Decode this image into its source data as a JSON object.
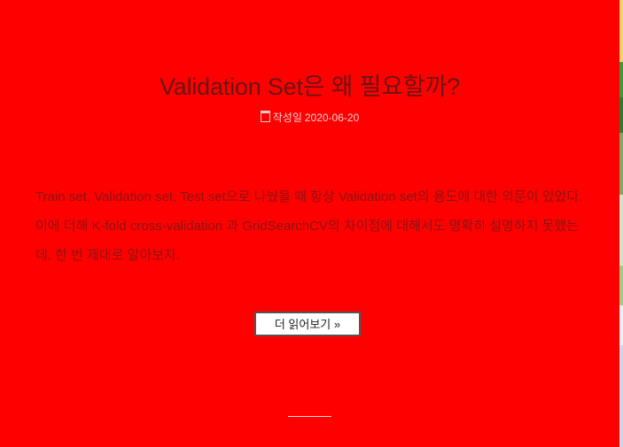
{
  "post": {
    "title": "Validation Set은 왜 필요할까?",
    "meta_label": "작성일",
    "date": "2020-06-20",
    "excerpt": "Train set, Validation set, Test set으로 나눴을 때 항상 Validation set의 용도에 대한 의문이 있었다. 이에 더해 K-fold cross-validation 과 GridSearchCV의 차이점에 대해서도 명확히 설명하지 못했는데, 한 번 제대로 알아보자.",
    "read_more": "더 읽어보기 »"
  },
  "icons": {
    "date_icon": "calendar-icon"
  },
  "colors": {
    "background": "#ff0000",
    "title": "#6b1414",
    "excerpt": "#8a1414",
    "meta": "#f6cccc",
    "button_bg": "#ffffff",
    "button_border": "#555555"
  }
}
